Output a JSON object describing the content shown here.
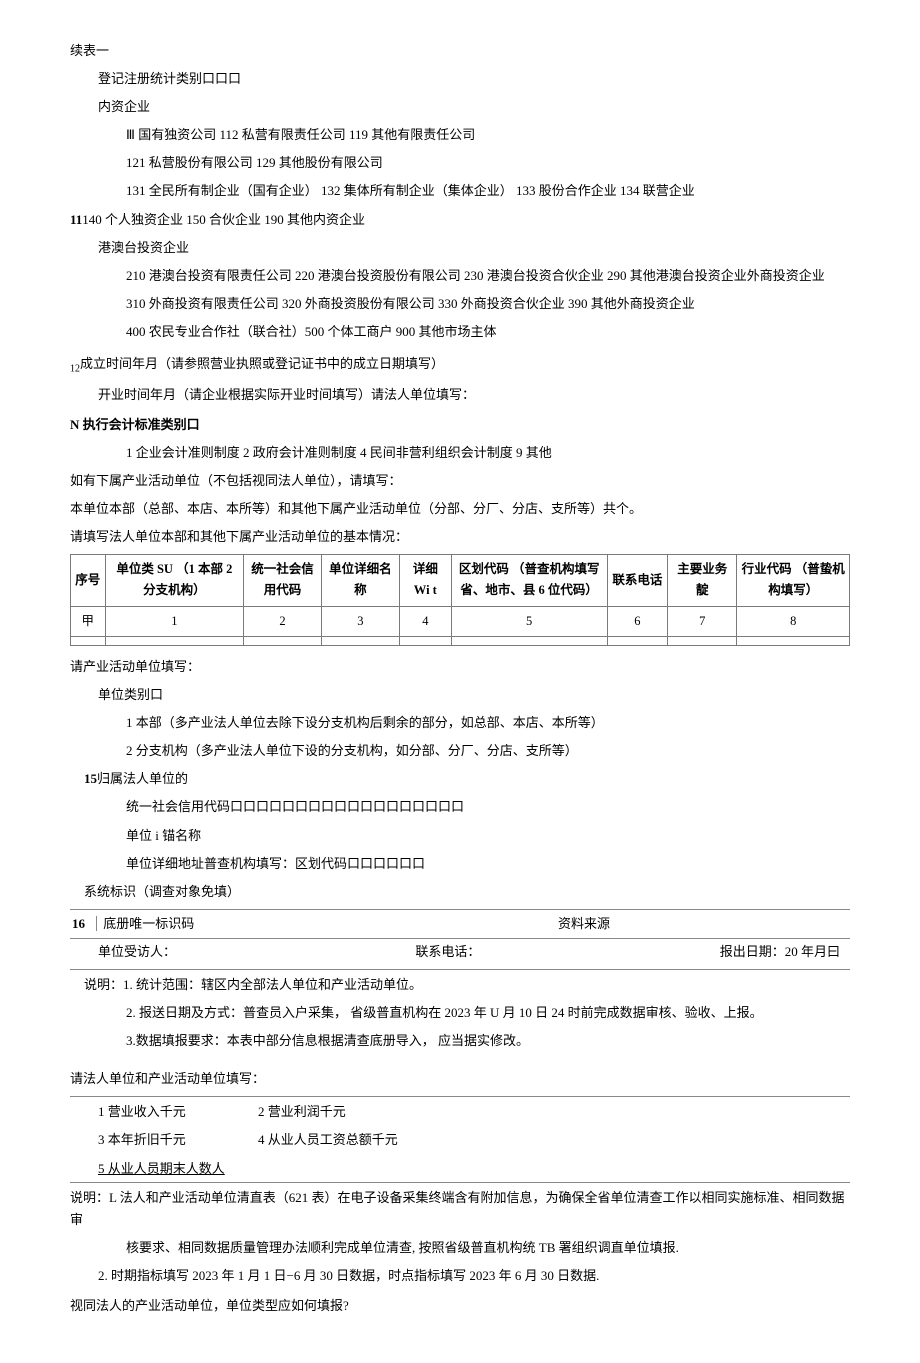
{
  "header": {
    "title": "续表一"
  },
  "reg": {
    "label": "登记注册统计类别口口口",
    "domestic_label": "内资企业",
    "domestic_line1": "Ⅲ 国有独资公司 112 私营有限责任公司 119 其他有限责任公司",
    "domestic_line2": "121 私营股份有限公司 129 其他股份有限公司",
    "domestic_line3": "131 全民所有制企业（国有企业） 132 集体所有制企业（集体企业） 133 股份合作企业 134 联营企业",
    "domestic_line4_prefix": "11",
    "domestic_line4": "140 个人独资企业          150 合伙企业 190 其他内资企业",
    "hmt_label": "港澳台投资企业",
    "hmt_line1": "210 港澳台投资有限责任公司 220 港澳台投资股份有限公司 230 港澳台投资合伙企业 290 其他港澳台投资企业外商投资企业",
    "foreign_line1": "310 外商投资有限责任公司 320 外商投资股份有限公司 330 外商投资合伙企业 390 其他外商投资企业",
    "other_line": "400 农民专业合作社（联合社）500 个体工商户                         900 其他市场主体"
  },
  "establish": {
    "num": "12",
    "line1": "成立时间年月（请参照营业执照或登记证书中的成立日期填写）",
    "line2": "开业时间年月（请企业根据实际开业时间填写）请法人单位填写："
  },
  "accounting": {
    "prefix": "N ",
    "label": "执行会计标准类别口",
    "options": "1 企业会计准则制度            2 政府会计准则制度            4 民间非营利组织会计制度 9 其他"
  },
  "subunits": {
    "line1": "如有下属产业活动单位（不包括视同法人单位），请填写：",
    "line2": "本单位本部（总部、本店、本所等）和其他下属产业活动单位（分部、分厂、分店、支所等）共个。",
    "line3": "请填写法人单位本部和其他下属产业活动单位的基本情况："
  },
  "table": {
    "headers": [
      "序号",
      "单位类 SU （1 本部 2 分支机构）",
      "统一社会信用代码",
      "单位详细名称",
      "详细\nWi t",
      "区划代码\n（普查机构填写省、地市、县 6 位代码）",
      "联系电话",
      "主要业务靛",
      "行业代码\n（普蛰机构填写）"
    ],
    "row1": [
      "甲",
      "1",
      "2",
      "3",
      "4",
      "5",
      "6",
      "7",
      "8"
    ],
    "row2": [
      "",
      "",
      "",
      "",
      "",
      "",
      "",
      "",
      ""
    ]
  },
  "activity": {
    "heading": "请产业活动单位填写：",
    "type_label": "单位类别口",
    "type1": "1 本部（多产业法人单位去除下设分支机构后剩余的部分，如总部、本店、本所等）",
    "type2": "2 分支机构（多产业法人单位下设的分支机构，如分部、分厂、分店、支所等）",
    "num15": "15",
    "belong_label": "归属法人单位的",
    "usc": "统一社会信用代码口口口口口口口口口口口口口口口口口口",
    "unitname": "单位 i 锚名称",
    "detail_addr": "单位详细地址普查机构填写：区划代码口口口口口口"
  },
  "system": {
    "label": "系统标识（调查对象免填）",
    "num": "16",
    "id_label": "底册唯一标识码",
    "source_label": "资料来源"
  },
  "footer1": {
    "receiver": "单位受访人：",
    "phone": "联系电话：",
    "date": "报出日期：20      年月曰"
  },
  "notes1": {
    "l1": "说明：1. 统计范围：辖区内全部法人单位和产业活动单位。",
    "l2": "2. 报送日期及方式：普查员入户采集， 省级普直机构在 2023 年 U 月 10 日 24 时前完成数据审核、验收、上报。",
    "l3": "3.数据填报要求：本表中部分信息根据清查底册导入， 应当据实修改。"
  },
  "legal_activity": {
    "heading": "请法人单位和产业活动单位填写：",
    "r1a": "1 营业收入千元",
    "r1b": "2 营业利润千元",
    "r2a": "3 本年折旧千元",
    "r2b": "4 从业人员工资总额千元",
    "r3": "5 从业人员期末人数人"
  },
  "notes2": {
    "l1a": "说明：L 法人和产业活动单位清直表（621 表）在电子设备采集终端含有附加信息，为确保全省单位清查工作以相同实施标准、相同数据审",
    "l1b": "核要求、相同数据质量管理办法顺利完成单位清查, 按照省级普直机构统 TB 署组织调直单位填报.",
    "l2": "2. 时期指标填写 2023 年 1 月 1 日−6 月 30 日数据，时点指标填写 2023 年 6 月 30 日数据."
  },
  "question": "视同法人的产业活动单位，单位类型应如何填报?"
}
